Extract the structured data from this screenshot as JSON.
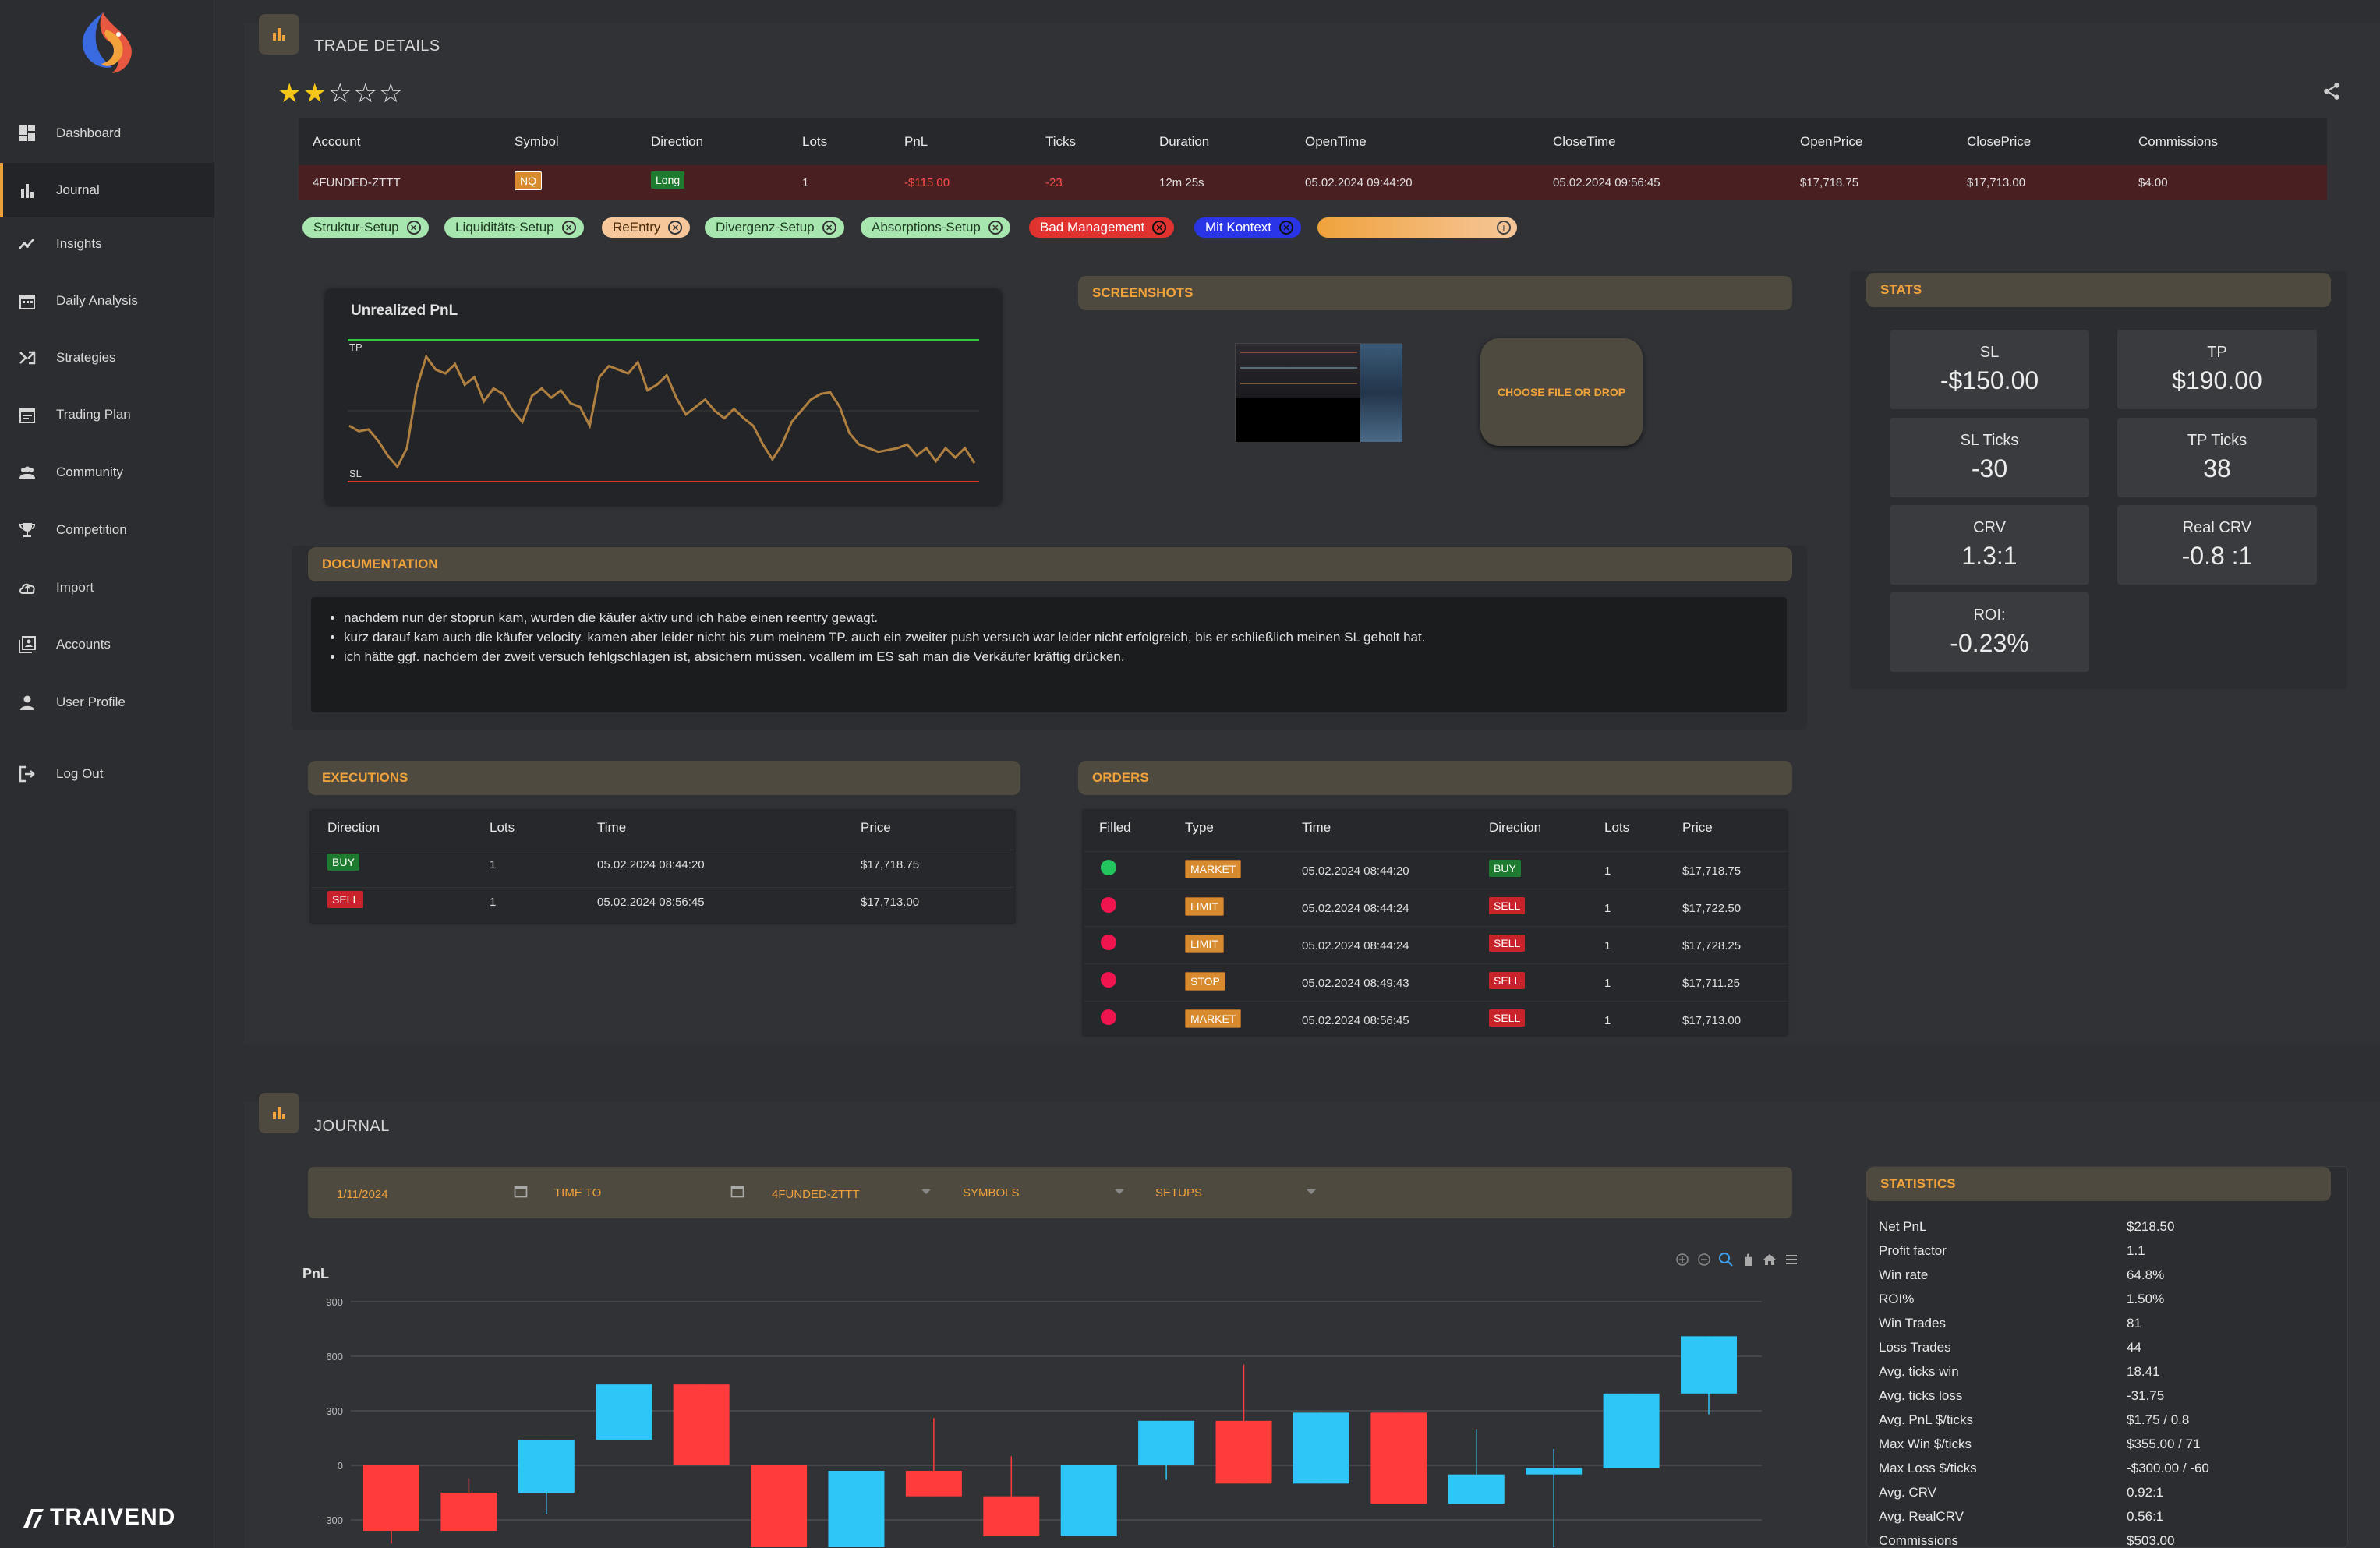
{
  "brand": {
    "name": "TRAIVEND"
  },
  "nav": [
    {
      "label": "Dashboard",
      "icon": "dashboard-icon"
    },
    {
      "label": "Journal",
      "icon": "bar-chart-icon"
    },
    {
      "label": "Insights",
      "icon": "trend-icon"
    },
    {
      "label": "Daily Analysis",
      "icon": "calendar-icon"
    },
    {
      "label": "Strategies",
      "icon": "shuffle-icon"
    },
    {
      "label": "Trading Plan",
      "icon": "calendar-list-icon"
    },
    {
      "label": "Community",
      "icon": "people-icon"
    },
    {
      "label": "Competition",
      "icon": "trophy-icon"
    },
    {
      "label": "Import",
      "icon": "cloud-upload-icon"
    },
    {
      "label": "Accounts",
      "icon": "accounts-icon"
    },
    {
      "label": "User Profile",
      "icon": "person-icon"
    },
    {
      "label": "Log Out",
      "icon": "logout-icon"
    }
  ],
  "trade": {
    "title": "TRADE DETAILS",
    "rating": 2,
    "rating_max": 5,
    "headers": [
      "Account",
      "Symbol",
      "Direction",
      "Lots",
      "PnL",
      "Ticks",
      "Duration",
      "OpenTime",
      "CloseTime",
      "OpenPrice",
      "ClosePrice",
      "Commissions"
    ],
    "row": [
      "4FUNDED-ZTTT",
      "NQ",
      "Long",
      "1",
      "-$115.00",
      "-23",
      "12m 25s",
      "05.02.2024 09:44:20",
      "05.02.2024 09:56:45",
      "$17,718.75",
      "$17,713.00",
      "$4.00"
    ],
    "tags": [
      {
        "label": "Struktur-Setup",
        "bg": "#a8e6b0",
        "fg": "#1b3a1f"
      },
      {
        "label": "Liquiditäts-Setup",
        "bg": "#a8e6b0",
        "fg": "#1b3a1f"
      },
      {
        "label": "ReEntry",
        "bg": "#f6c79a",
        "fg": "#4a2a0a"
      },
      {
        "label": "Divergenz-Setup",
        "bg": "#a8e6b0",
        "fg": "#1b3a1f"
      },
      {
        "label": "Absorptions-Setup",
        "bg": "#a8e6b0",
        "fg": "#1b3a1f"
      },
      {
        "label": "Bad Management",
        "bg": "#e0322f",
        "fg": "#ffffff"
      },
      {
        "label": "Mit Kontext",
        "bg": "#2a35e8",
        "fg": "#ffffff"
      }
    ]
  },
  "unrealized": {
    "title": "Unrealized PnL",
    "tp": "TP",
    "sl": "SL"
  },
  "screenshots": {
    "title": "SCREENSHOTS",
    "upload": "CHOOSE FILE OR DROP"
  },
  "stats": {
    "title": "STATS",
    "boxes": [
      {
        "label": "SL",
        "value": "-$150.00"
      },
      {
        "label": "TP",
        "value": "$190.00"
      },
      {
        "label": "SL Ticks",
        "value": "-30"
      },
      {
        "label": "TP Ticks",
        "value": "38"
      },
      {
        "label": "CRV",
        "value": "1.3:1"
      },
      {
        "label": "Real CRV",
        "value": "-0.8 :1"
      },
      {
        "label": "ROI:",
        "value": "-0.23%"
      }
    ]
  },
  "documentation": {
    "title": "DOCUMENTATION",
    "items": [
      "nachdem nun der stoprun kam, wurden die käufer aktiv und ich habe einen reentry gewagt.",
      "kurz darauf kam auch die käufer velocity. kamen aber leider nicht bis zum meinem TP. auch ein zweiter push versuch war leider nicht erfolgreich, bis er schließlich meinen SL geholt hat.",
      "ich hätte ggf. nachdem der zweit versuch fehlgschlagen ist, absichern müssen. voallem im ES sah man die Verkäufer kräftig drücken."
    ]
  },
  "executions": {
    "title": "EXECUTIONS",
    "headers": [
      "Direction",
      "Lots",
      "Time",
      "Price"
    ],
    "rows": [
      {
        "direction": "BUY",
        "lots": "1",
        "time": "05.02.2024 08:44:20",
        "price": "$17,718.75"
      },
      {
        "direction": "SELL",
        "lots": "1",
        "time": "05.02.2024 08:56:45",
        "price": "$17,713.00"
      }
    ]
  },
  "orders": {
    "title": "ORDERS",
    "headers": [
      "Filled",
      "Type",
      "Time",
      "Direction",
      "Lots",
      "Price"
    ],
    "rows": [
      {
        "filled": true,
        "type": "MARKET",
        "time": "05.02.2024 08:44:20",
        "direction": "BUY",
        "lots": "1",
        "price": "$17,718.75"
      },
      {
        "filled": false,
        "type": "LIMIT",
        "time": "05.02.2024 08:44:24",
        "direction": "SELL",
        "lots": "1",
        "price": "$17,722.50"
      },
      {
        "filled": false,
        "type": "LIMIT",
        "time": "05.02.2024 08:44:24",
        "direction": "SELL",
        "lots": "1",
        "price": "$17,728.25"
      },
      {
        "filled": false,
        "type": "STOP",
        "time": "05.02.2024 08:49:43",
        "direction": "SELL",
        "lots": "1",
        "price": "$17,711.25"
      },
      {
        "filled": false,
        "type": "MARKET",
        "time": "05.02.2024 08:56:45",
        "direction": "SELL",
        "lots": "1",
        "price": "$17,713.00"
      }
    ]
  },
  "journal": {
    "title": "JOURNAL",
    "filters": {
      "date_from": "1/11/2024",
      "time_to": "TIME TO",
      "account": "4FUNDED-ZTTT",
      "symbols": "SYMBOLS",
      "setups": "SETUPS"
    }
  },
  "statistics": {
    "title": "STATISTICS",
    "rows": [
      {
        "k": "Net PnL",
        "v": "$218.50"
      },
      {
        "k": "Profit factor",
        "v": "1.1"
      },
      {
        "k": "Win rate",
        "v": "64.8%"
      },
      {
        "k": "ROI%",
        "v": "1.50%"
      },
      {
        "k": "Win Trades",
        "v": "81"
      },
      {
        "k": "Loss Trades",
        "v": "44"
      },
      {
        "k": "Avg. ticks win",
        "v": "18.41"
      },
      {
        "k": "Avg. ticks loss",
        "v": "-31.75"
      },
      {
        "k": "Avg. PnL $/ticks",
        "v": "$1.75 / 0.8"
      },
      {
        "k": "Max Win $/ticks",
        "v": "$355.00 / 71"
      },
      {
        "k": "Max Loss $/ticks",
        "v": "-$300.00 / -60"
      },
      {
        "k": "Avg. CRV",
        "v": "0.92:1"
      },
      {
        "k": "Avg. RealCRV",
        "v": "0.56:1"
      },
      {
        "k": "Commissions",
        "v": "$503.00"
      }
    ]
  },
  "chart_data": {
    "type": "candlestick",
    "ylabel": "PnL",
    "ylim": [
      -450,
      950
    ],
    "yticks": [
      900,
      600,
      300,
      0,
      -300
    ],
    "candles": [
      {
        "open": 0,
        "close": -360,
        "high": 0,
        "low": -430
      },
      {
        "open": -150,
        "close": -360,
        "high": -70,
        "low": -360
      },
      {
        "open": -150,
        "close": 140,
        "high": 140,
        "low": -270
      },
      {
        "open": 140,
        "close": 445,
        "high": 445,
        "low": 140
      },
      {
        "open": 445,
        "close": 0,
        "high": 445,
        "low": 0
      },
      {
        "open": 0,
        "close": -450,
        "high": 0,
        "low": -450
      },
      {
        "open": -450,
        "close": -30,
        "high": -30,
        "low": -450
      },
      {
        "open": -30,
        "close": -170,
        "high": 260,
        "low": -170
      },
      {
        "open": -170,
        "close": -390,
        "high": 50,
        "low": -390
      },
      {
        "open": -390,
        "close": 0,
        "high": 0,
        "low": -390
      },
      {
        "open": 0,
        "close": 245,
        "high": 245,
        "low": -80
      },
      {
        "open": 245,
        "close": -100,
        "high": 555,
        "low": -100
      },
      {
        "open": -100,
        "close": 290,
        "high": 290,
        "low": -100
      },
      {
        "open": 290,
        "close": -210,
        "high": 290,
        "low": -210
      },
      {
        "open": -210,
        "close": -50,
        "high": 200,
        "low": -210
      },
      {
        "open": -50,
        "close": -15,
        "high": 90,
        "low": -450
      },
      {
        "open": -15,
        "close": 395,
        "high": 395,
        "low": -15
      },
      {
        "open": 395,
        "close": 710,
        "high": 710,
        "low": 280
      }
    ],
    "up_color": "#2ec5f7",
    "down_color": "#ff3b3b"
  },
  "pnl_chart": {
    "type": "line",
    "title": "Unrealized PnL",
    "values": [
      -40,
      -55,
      -50,
      -80,
      -120,
      -150,
      -100,
      60,
      145,
      110,
      100,
      125,
      70,
      90,
      25,
      60,
      45,
      0,
      -30,
      40,
      60,
      35,
      55,
      20,
      10,
      -40,
      90,
      120,
      110,
      100,
      130,
      55,
      70,
      95,
      35,
      -10,
      10,
      30,
      0,
      -20,
      5,
      -20,
      -40,
      -90,
      -130,
      -90,
      -30,
      0,
      30,
      45,
      50,
      10,
      -60,
      -90,
      -100,
      -110,
      -105,
      -100,
      -90,
      -120,
      -100,
      -135,
      -100,
      -125,
      -100,
      -140
    ],
    "ylim": [
      -190,
      190
    ],
    "line_color": "#b08040"
  },
  "colors": {
    "accent": "#f0a23c",
    "pnl_negative": "#ff4d4d",
    "row_bg": "#4a1f22",
    "bg": "#2d2f32"
  }
}
